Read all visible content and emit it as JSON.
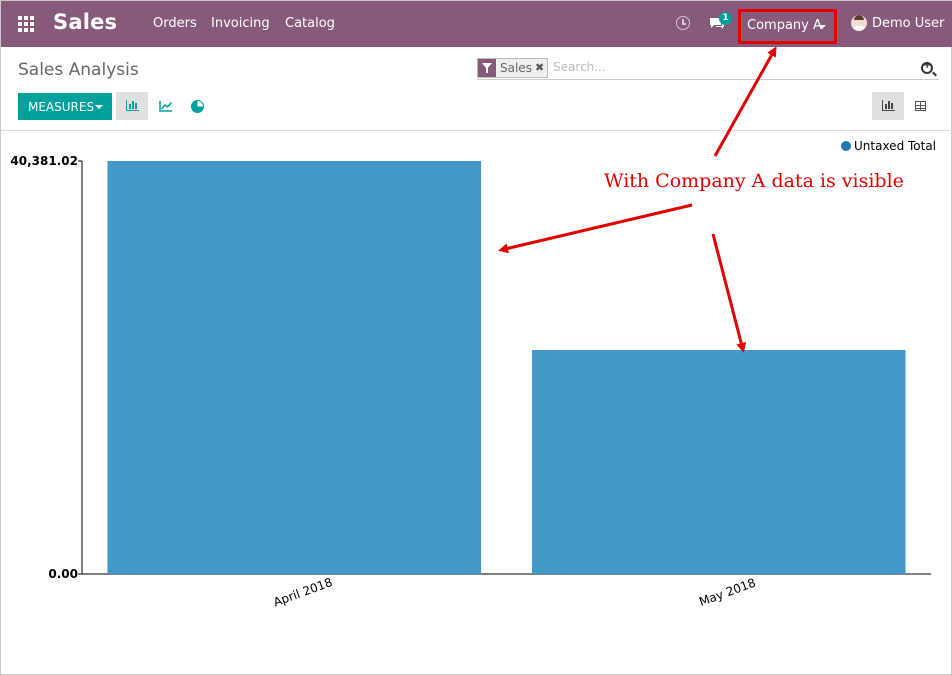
{
  "topbar": {
    "app_name": "Sales",
    "menu": [
      "Orders",
      "Invoicing",
      "Catalog"
    ],
    "chat_badge": "1",
    "company": "Company A",
    "user": "Demo User",
    "icons": [
      "apps-grid-icon",
      "clock-icon",
      "chat-icon",
      "user-avatar"
    ]
  },
  "control_panel": {
    "title": "Sales Analysis",
    "facet": "Sales",
    "facet_remove": "✖",
    "search_placeholder": "Search...",
    "measures_label": "MEASURES"
  },
  "chart_data": {
    "type": "bar",
    "categories": [
      "April 2018",
      "May 2018"
    ],
    "series": [
      {
        "name": "Untaxed Total",
        "values": [
          40381.02,
          21900
        ],
        "color": "#1f77b4"
      }
    ],
    "y_tick_labels": [
      "40,381.02",
      "0.00"
    ],
    "ylim": [
      0,
      40381.02
    ],
    "legend_position": "top-right",
    "bar_color": "#4299c8"
  },
  "annotation": {
    "text": "With Company A data is visible",
    "color": "#e00000"
  }
}
